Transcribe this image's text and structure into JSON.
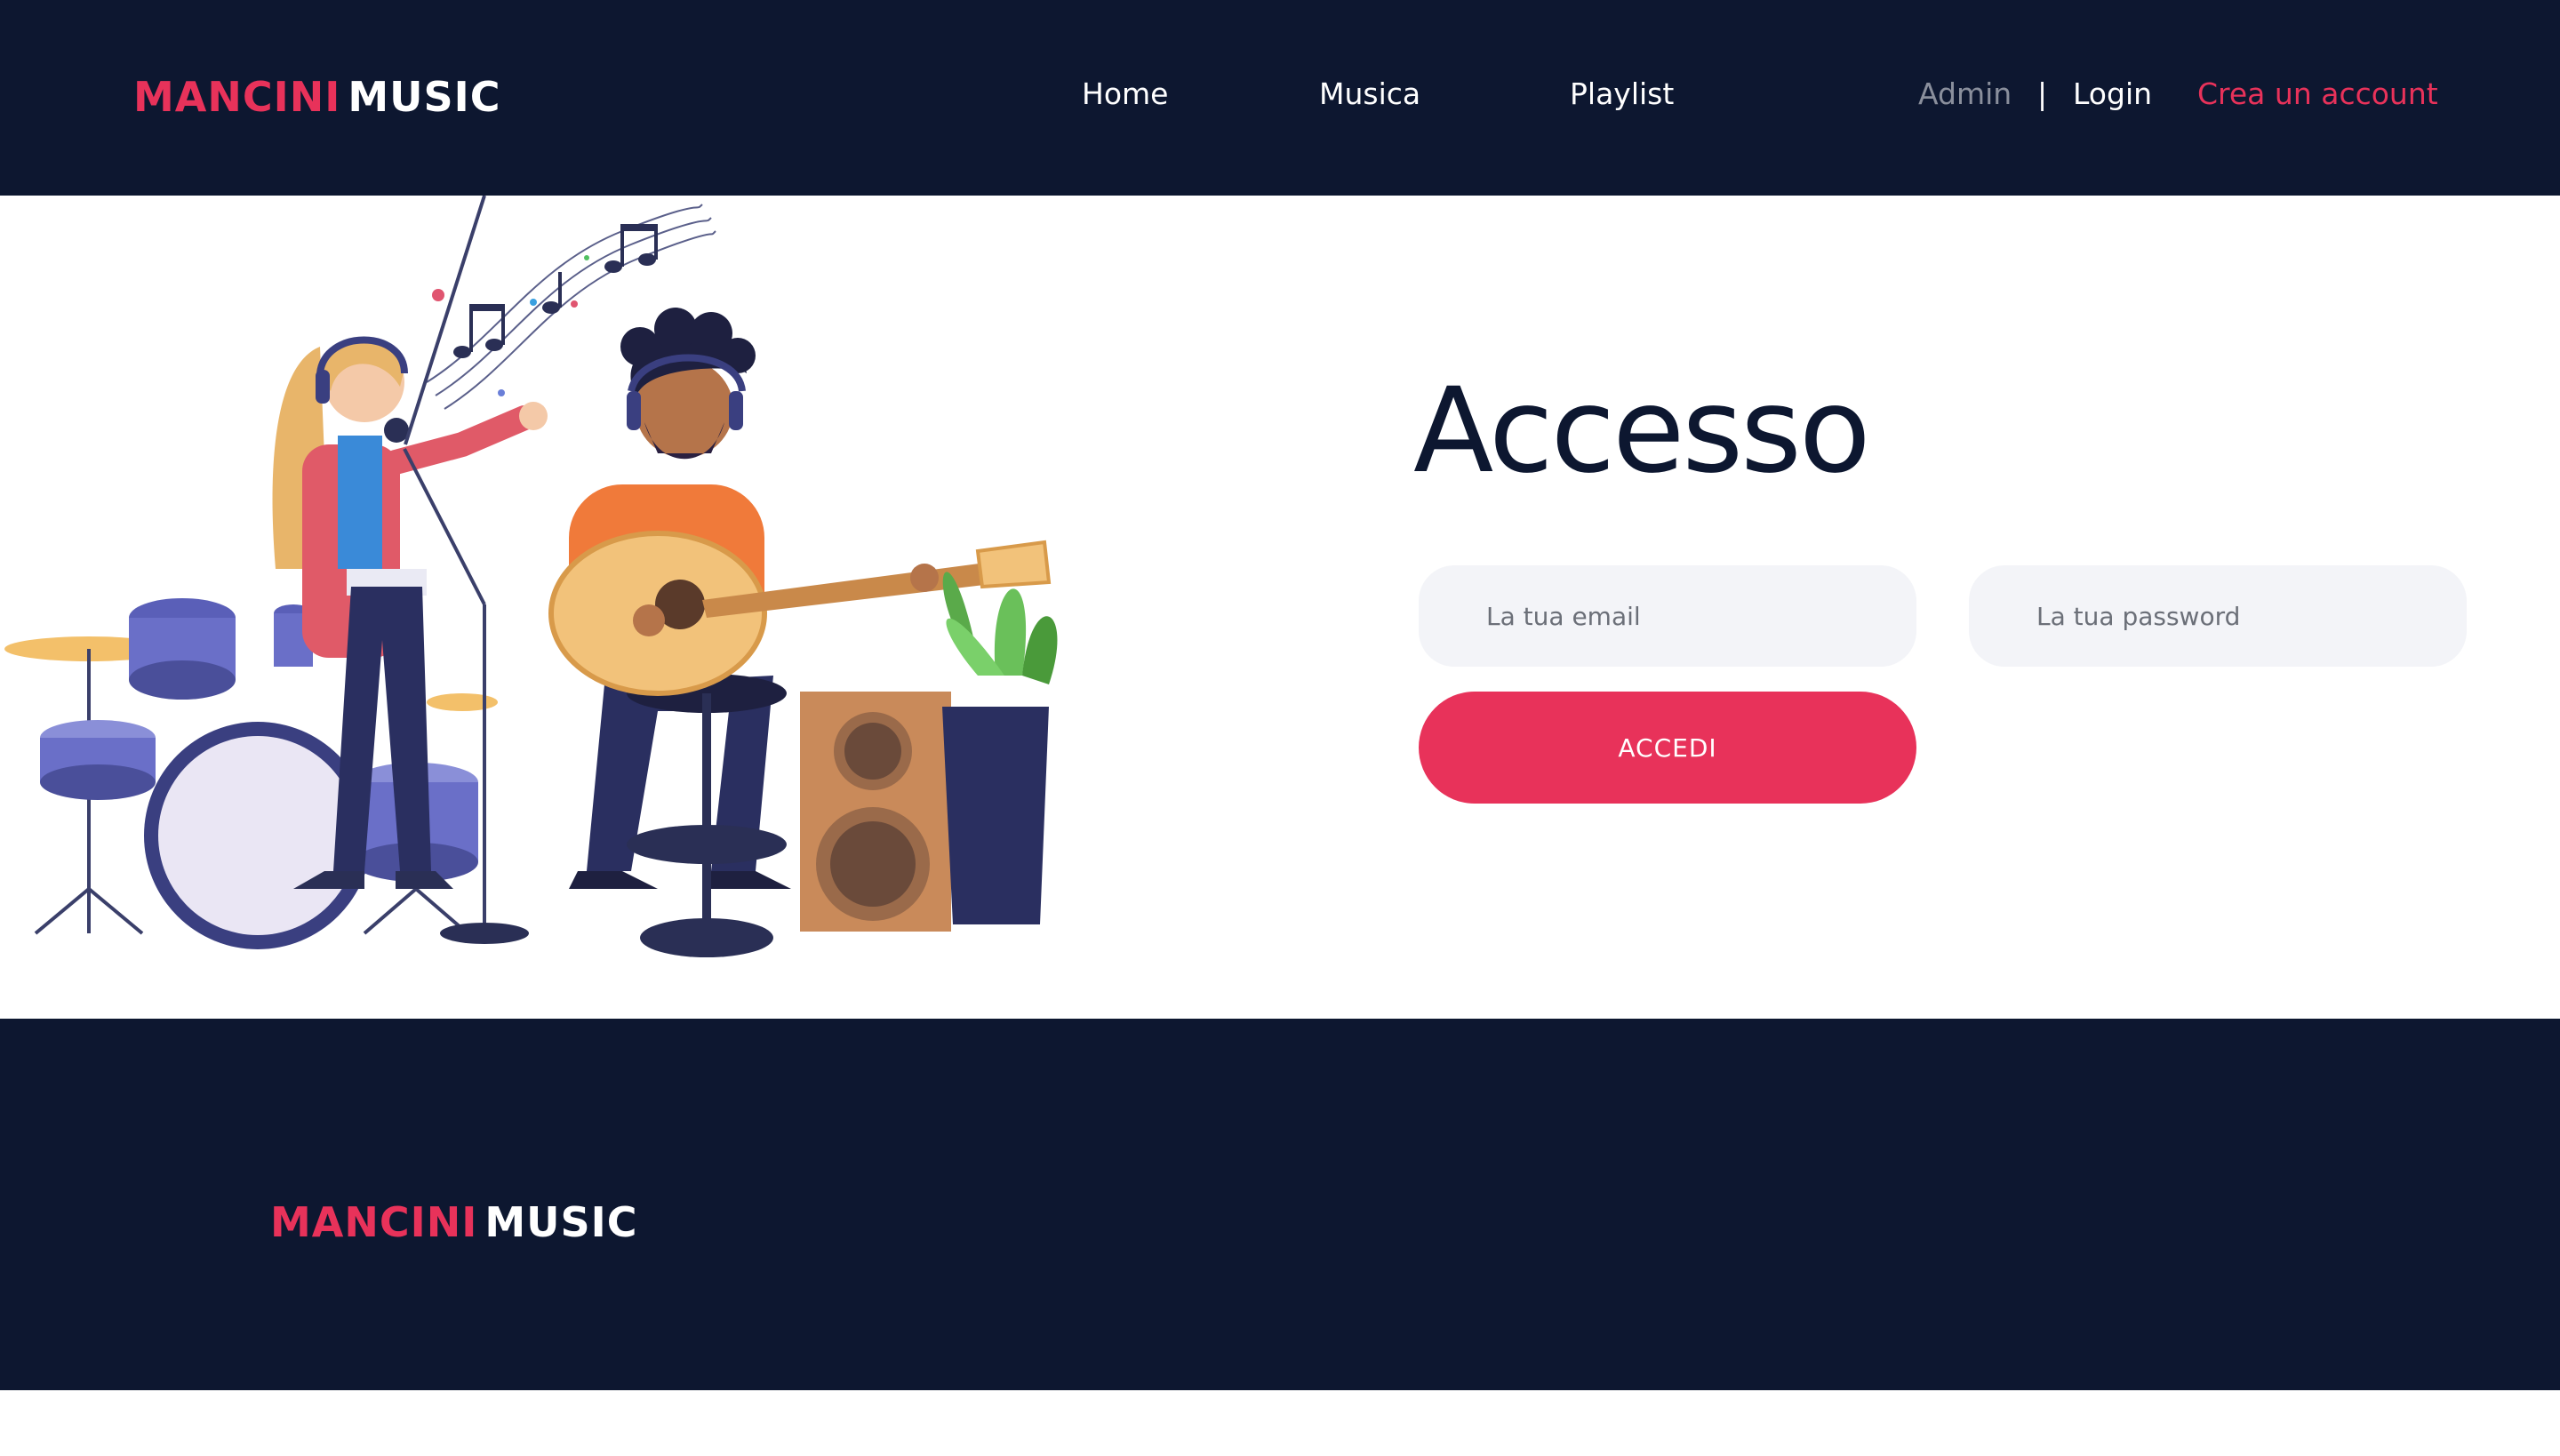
{
  "header": {
    "logo": {
      "part1": "MANCINI",
      "part2": "MUSIC"
    },
    "nav": [
      {
        "label": "Home"
      },
      {
        "label": "Musica"
      },
      {
        "label": "Playlist"
      }
    ],
    "admin_label": "Admin",
    "separator": "|",
    "login_label": "Login",
    "signup_label": "Crea un account"
  },
  "main": {
    "title": "Accesso",
    "email_placeholder": "La tua email",
    "password_placeholder": "La tua password",
    "submit_label": "ACCEDI"
  },
  "footer": {
    "logo": {
      "part1": "MANCINI",
      "part2": "MUSIC"
    }
  },
  "colors": {
    "navy": "#0d1730",
    "accent": "#e8325a",
    "field_bg": "#f3f4f8",
    "muted": "#8a8f9c"
  },
  "icons": {
    "illustration": "musicians-illustration"
  }
}
